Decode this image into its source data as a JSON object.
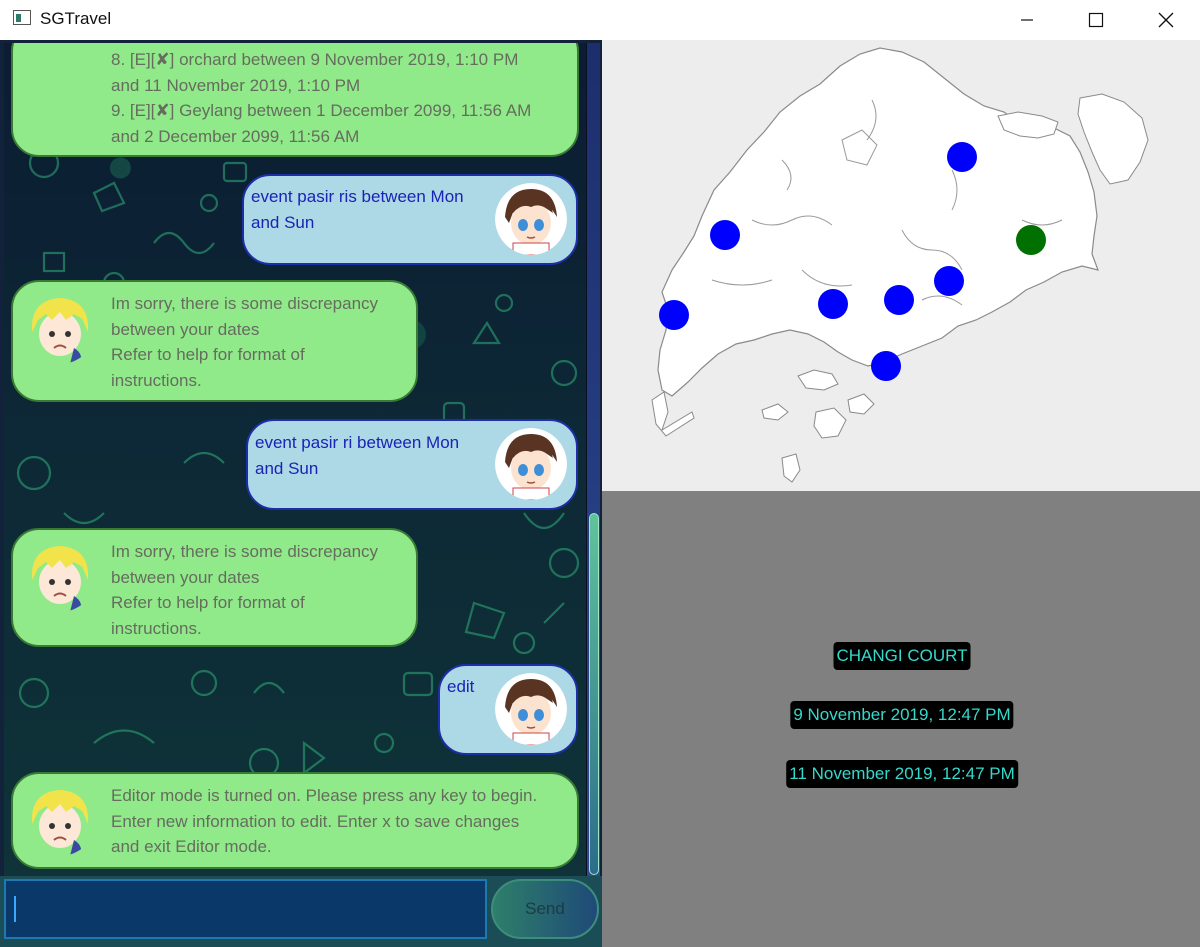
{
  "window": {
    "title": "SGTravel",
    "icon": "app-window-icon",
    "controls": [
      "minimize-icon",
      "maximize-icon",
      "close-icon"
    ]
  },
  "chat": {
    "messages": [
      {
        "sender": "bot",
        "lines": [
          "8. [E][✘] orchard between 9 November 2019, 1:10 PM",
          "and 11 November 2019, 1:10 PM",
          "9. [E][✘] Geylang between 1 December 2099, 11:56 AM",
          "and 2 December 2099, 11:56 AM"
        ]
      },
      {
        "sender": "user",
        "lines": [
          "event pasir ris between Mon",
          "and Sun"
        ]
      },
      {
        "sender": "bot",
        "lines": [
          "Im sorry, there is some discrepancy",
          "between your dates",
          "Refer to help for format of",
          "instructions."
        ]
      },
      {
        "sender": "user",
        "lines": [
          "event pasir ri between Mon",
          "and Sun"
        ]
      },
      {
        "sender": "bot",
        "lines": [
          "Im sorry, there is some discrepancy",
          "between your dates",
          "Refer to help for format of",
          "instructions."
        ]
      },
      {
        "sender": "user",
        "lines": [
          "edit"
        ]
      },
      {
        "sender": "bot",
        "lines": [
          "Editor mode is turned on. Please press any key to begin.",
          "Enter new information to edit. Enter x to save changes",
          "and exit Editor mode."
        ]
      }
    ],
    "input": {
      "value": "",
      "placeholder": ""
    },
    "send_label": "Send"
  },
  "map": {
    "markers": [
      {
        "name": "marker-north-east",
        "color": "#0000ff"
      },
      {
        "name": "marker-west",
        "color": "#0000ff"
      },
      {
        "name": "marker-green",
        "color": "#007000"
      },
      {
        "name": "marker-far-west",
        "color": "#0000ff"
      },
      {
        "name": "marker-central-west",
        "color": "#0000ff"
      },
      {
        "name": "marker-central",
        "color": "#0000ff"
      },
      {
        "name": "marker-east",
        "color": "#0000ff"
      },
      {
        "name": "marker-south",
        "color": "#0000ff"
      }
    ]
  },
  "details": {
    "location": "CHANGI COURT",
    "start": "9 November 2019, 12:47 PM",
    "end": "11 November 2019, 12:47 PM"
  },
  "colors": {
    "bot_bubble": "#90ea8a",
    "user_bubble": "#add8e6",
    "user_text": "#1a23b5",
    "bot_text": "#666c5e",
    "detail_text": "#36d8cc",
    "marker_blue": "#0000ff",
    "marker_green": "#007000"
  }
}
